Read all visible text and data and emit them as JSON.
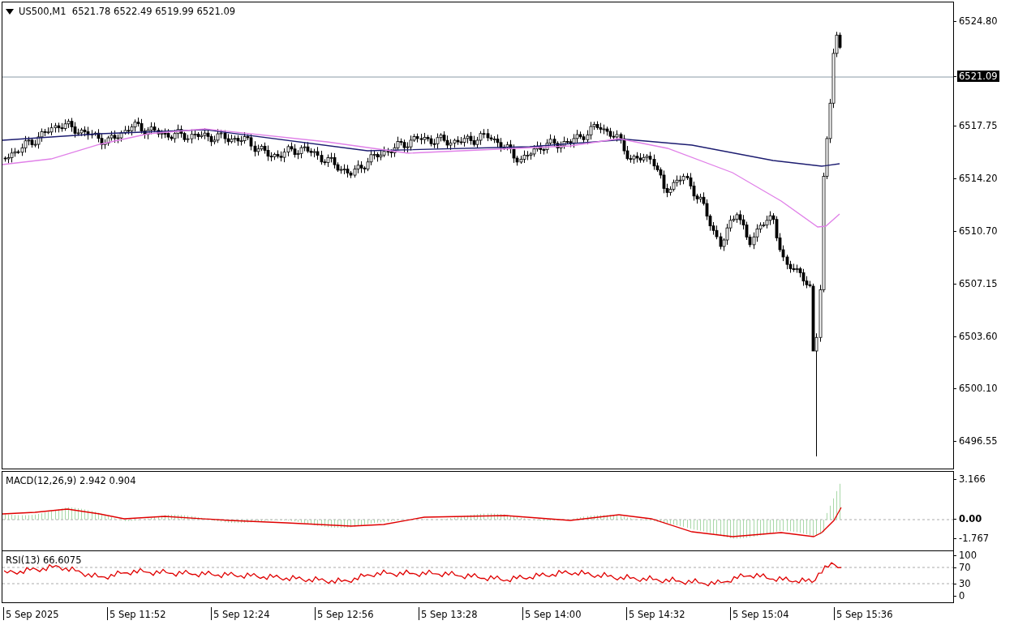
{
  "chart_header": {
    "symbol": "US500,M1",
    "quote": "6521.78 6522.49 6519.99 6521.09"
  },
  "price_axis": {
    "ticks": [
      "6524.80",
      "6517.75",
      "6514.20",
      "6510.70",
      "6507.15",
      "6503.60",
      "6500.10",
      "6496.55"
    ],
    "current_price": "6521.09"
  },
  "macd_panel": {
    "label": "MACD(12,26,9) 2.942 0.904",
    "ticks": [
      "3.166",
      "0.00",
      "-1.767"
    ]
  },
  "rsi_panel": {
    "label": "RSI(13) 66.6075",
    "ticks": [
      "100",
      "70",
      "30",
      "0"
    ]
  },
  "time_axis": {
    "labels": [
      "5 Sep 2025",
      "5 Sep 11:52",
      "5 Sep 12:24",
      "5 Sep 12:56",
      "5 Sep 13:28",
      "5 Sep 14:00",
      "5 Sep 14:32",
      "5 Sep 15:04",
      "5 Sep 15:36"
    ]
  }
}
